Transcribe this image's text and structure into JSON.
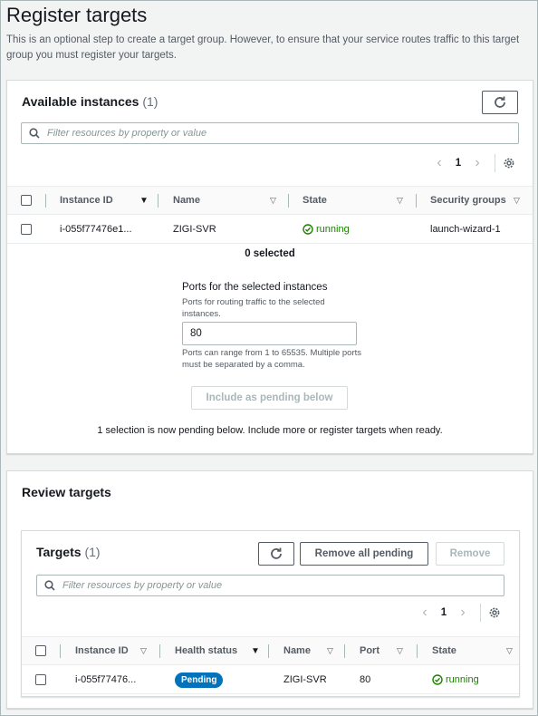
{
  "page": {
    "title": "Register targets",
    "description": "This is an optional step to create a target group. However, to ensure that your service routes traffic to this target group you must register your targets."
  },
  "available": {
    "title": "Available instances",
    "count": "(1)",
    "filter_placeholder": "Filter resources by property or value",
    "page_number": "1",
    "columns": [
      "Instance ID",
      "Name",
      "State",
      "Security groups"
    ],
    "rows": [
      {
        "instance_id": "i-055f77476e1...",
        "name": "ZIGI-SVR",
        "state": "running",
        "security_group": "launch-wizard-1"
      }
    ],
    "selected_text": "0 selected",
    "ports_label": "Ports for the selected instances",
    "ports_desc": "Ports for routing traffic to the selected instances.",
    "port_value": "80",
    "ports_hint": "Ports can range from 1 to 65535. Multiple ports must be separated by a comma.",
    "include_button": "Include as pending below",
    "pending_message": "1 selection is now pending below. Include more or register targets when ready."
  },
  "review": {
    "title": "Review targets",
    "targets_title": "Targets",
    "targets_count": "(1)",
    "remove_all_button": "Remove all pending",
    "remove_button": "Remove",
    "filter_placeholder": "Filter resources by property or value",
    "page_number": "1",
    "columns": [
      "Instance ID",
      "Health status",
      "Name",
      "Port",
      "State"
    ],
    "rows": [
      {
        "instance_id": "i-055f77476...",
        "health": "Pending",
        "name": "ZIGI-SVR",
        "port": "80",
        "state": "running"
      }
    ]
  },
  "icons": {
    "refresh": "refresh-icon",
    "search": "search-icon",
    "settings": "gear-icon",
    "status": "check-circle-icon"
  },
  "colors": {
    "running": "#1d8102",
    "pending_badge": "#0073bb"
  }
}
